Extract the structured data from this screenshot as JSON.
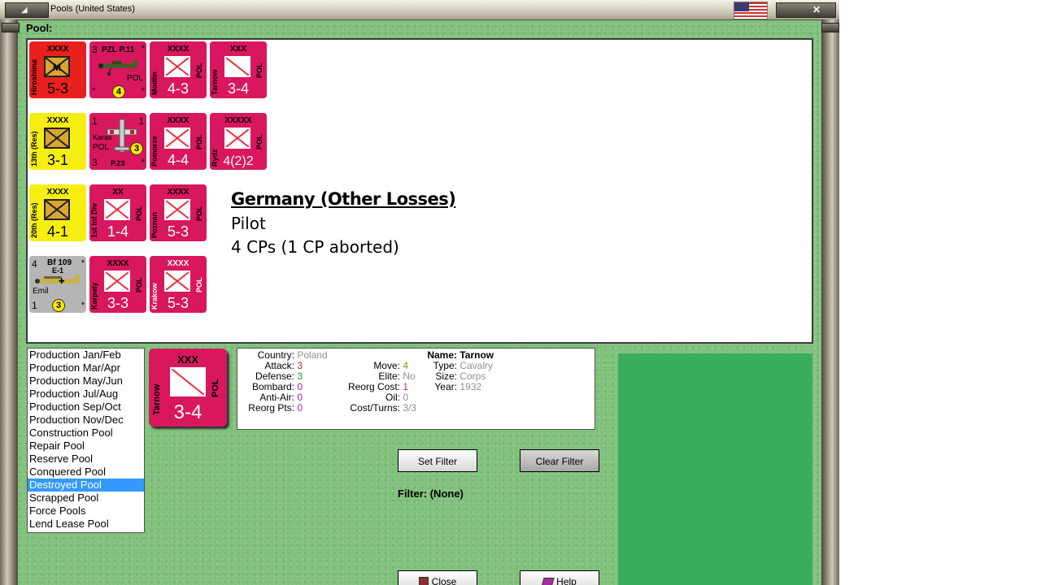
{
  "window": {
    "title": "Pools (United States)",
    "close_symbol": "✕",
    "left_button_symbol": "◢"
  },
  "pool": {
    "label": "Pool:",
    "counters": [
      {
        "id": "hiroshima",
        "name": "Hiroshima",
        "echelon": "XXXX",
        "strength": "5-3",
        "color": "red",
        "symbol": "M"
      },
      {
        "id": "pzl-p11",
        "name": "PZL P.11",
        "nation": "POL",
        "top_left": "3",
        "badge": "4"
      },
      {
        "id": "modlin",
        "name": "Modlin",
        "echelon": "XXXX",
        "strength": "4-3",
        "nation": "POL"
      },
      {
        "id": "tarnow-small",
        "name": "Tarnow",
        "echelon": "XXX",
        "strength": "3-4",
        "nation": "POL"
      },
      {
        "id": "13th-res",
        "name": "13th (Res)",
        "echelon": "XXXX",
        "strength": "3-1",
        "color": "yellow"
      },
      {
        "id": "karas",
        "name": "Karas",
        "model": "P.23",
        "nation": "POL",
        "top_left": "1",
        "top_right": "1",
        "bottom_left": "3",
        "badge": "3"
      },
      {
        "id": "pomorze",
        "name": "Pomorze",
        "echelon": "XXXX",
        "strength": "4-4",
        "nation": "POL"
      },
      {
        "id": "rydz",
        "name": "Rydz",
        "echelon": "XXXXX",
        "strength": "4(2)2",
        "nation": "POL"
      },
      {
        "id": "20th-res",
        "name": "20th (Res)",
        "echelon": "XXXX",
        "strength": "4-1",
        "color": "yellow"
      },
      {
        "id": "1st-inf-div",
        "name": "1st Inf Div",
        "echelon": "XX",
        "strength": "1-4",
        "nation": "POL"
      },
      {
        "id": "poznan",
        "name": "Poznan",
        "echelon": "XXXX",
        "strength": "5-3",
        "nation": "POL"
      },
      {
        "id": "bf109",
        "name": "Bf 109",
        "variant": "E-1",
        "nickname": "Emil",
        "top_left": "4",
        "bottom_left": "1",
        "badge": "3"
      },
      {
        "id": "karpaty",
        "name": "Karpaty",
        "echelon": "XXXX",
        "strength": "3-3",
        "nation": "POL"
      },
      {
        "id": "krakow",
        "name": "Krakow",
        "echelon": "XXXX",
        "strength": "5-3",
        "nation": "POL"
      }
    ],
    "star": "*"
  },
  "loss_info": {
    "country": "Germany (Other Losses)",
    "type": "Pilot",
    "cps": "4 CPs (1 CP aborted)"
  },
  "pool_list": {
    "items": [
      "Production Jan/Feb",
      "Production Mar/Apr",
      "Production May/Jun",
      "Production Jul/Aug",
      "Production Sep/Oct",
      "Production Nov/Dec",
      "Construction Pool",
      "Repair Pool",
      "Reserve Pool",
      "Conquered Pool",
      "Destroyed Pool",
      "Scrapped Pool",
      "Force Pools",
      "Lend Lease Pool"
    ],
    "selected": "Destroyed Pool"
  },
  "selected_unit": {
    "counter": {
      "name": "Tarnow",
      "echelon": "XXX",
      "strength": "3-4",
      "nation": "POL"
    },
    "country_label": "Country:",
    "country": "Poland",
    "attack_label": "Attack:",
    "attack": "3",
    "defense_label": "Defense:",
    "defense": "3",
    "bombard_label": "Bombard:",
    "bombard": "0",
    "antiair_label": "Anti-Air:",
    "antiair": "0",
    "reorgpts_label": "Reorg Pts:",
    "reorgpts": "0",
    "move_label": "Move:",
    "move": "4",
    "elite_label": "Elite:",
    "elite": "No",
    "reorgcost_label": "Reorg Cost:",
    "reorgcost": "1",
    "oil_label": "Oil:",
    "oil": "0",
    "costturns_label": "Cost/Turns:",
    "costturns": "3/3",
    "name_label": "Name:",
    "name": "Tarnow",
    "type_label": "Type:",
    "type": "Cavalry",
    "size_label": "Size:",
    "size": "Corps",
    "year_label": "Year:",
    "year": "1932"
  },
  "buttons": {
    "set_filter": "Set Filter",
    "clear_filter": "Clear Filter",
    "close": "Close",
    "help": "Help"
  },
  "filter": {
    "label": "Filter: (None)"
  }
}
